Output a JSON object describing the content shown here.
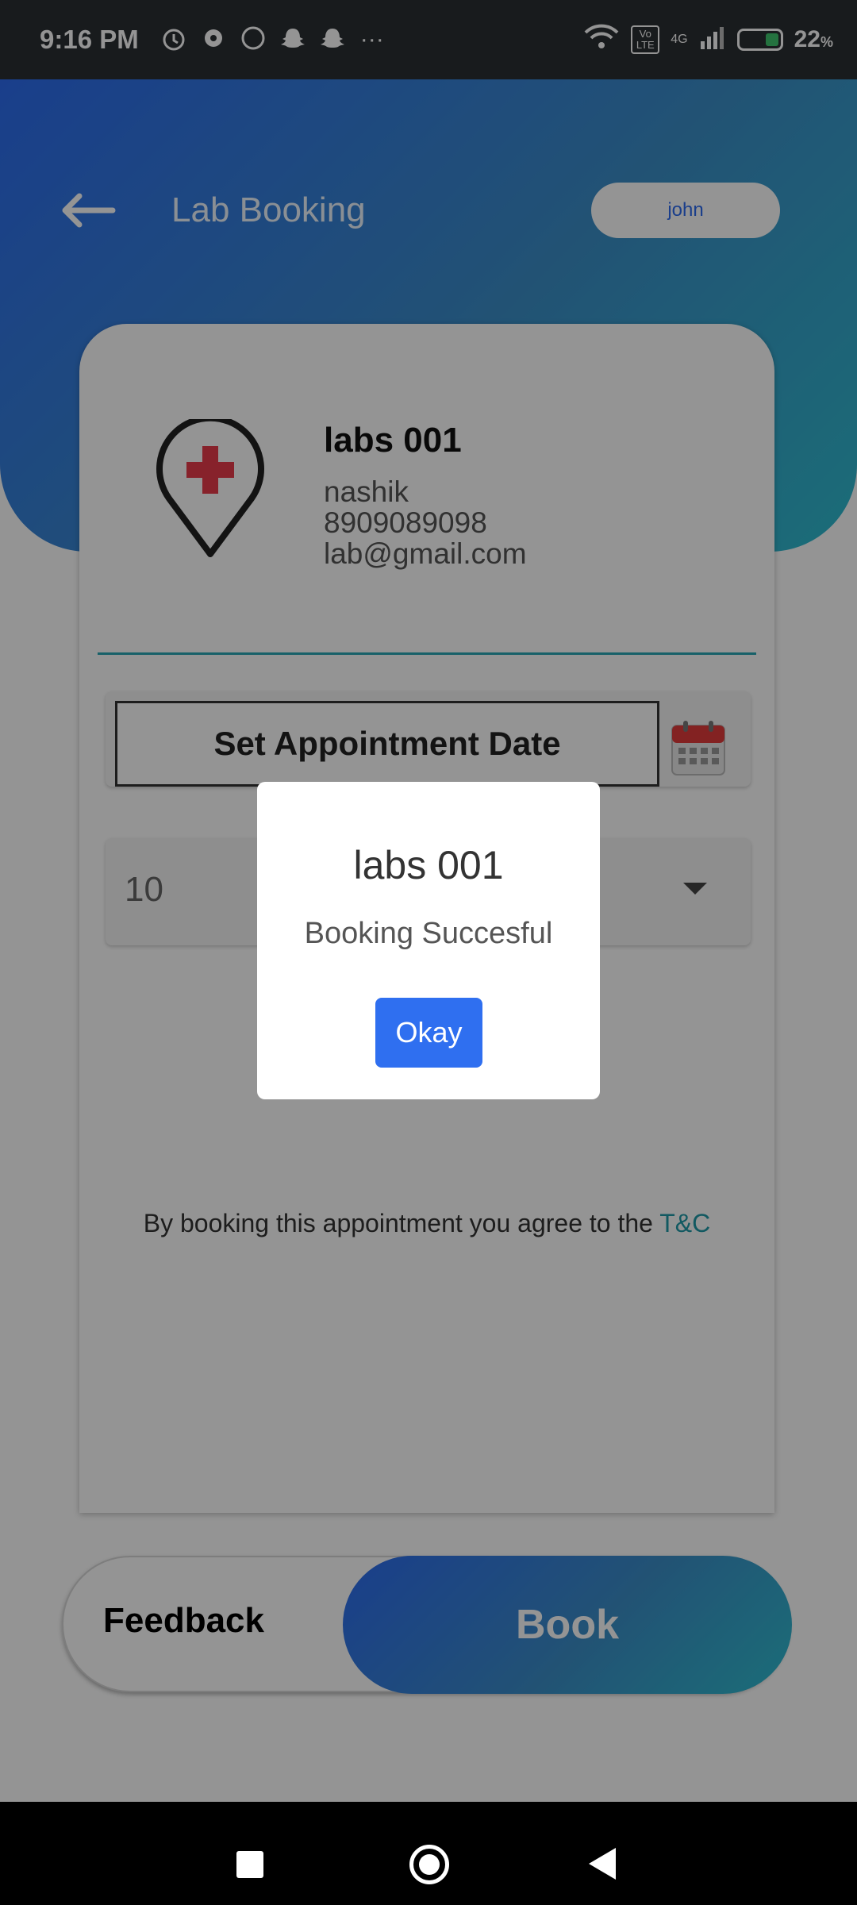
{
  "status_bar": {
    "time": "9:16 PM",
    "battery": "22",
    "battery_unit": "%",
    "network": "4G",
    "volte": "Vo LTE",
    "more": "···",
    "icons": [
      "alarm-icon",
      "settings-icon",
      "whatsapp-icon",
      "snapchat-icon",
      "snapchat-icon",
      "more-icon",
      "wifi-icon",
      "volte-icon",
      "signal-icon",
      "battery-charging-icon"
    ]
  },
  "header": {
    "title": "Lab Booking",
    "user": "john"
  },
  "lab": {
    "name": "labs 001",
    "city": "nashik",
    "phone": "8909089098",
    "email": "lab@gmail.com"
  },
  "booking": {
    "date_button_label": "Set Appointment Date",
    "slot_value": "10",
    "terms_text": "By booking this appointment you agree to the ",
    "terms_link": "T&C"
  },
  "actions": {
    "feedback_label": "Feedback",
    "book_label": "Book"
  },
  "dialog": {
    "title": "labs 001",
    "message": "Booking Succesful",
    "ok_label": "Okay"
  },
  "colors": {
    "brand_gradient_start": "#2d6cf0",
    "brand_gradient_end": "#2fbdd0",
    "accent_teal": "#1f9aa8",
    "button_blue": "#2f6ff0"
  }
}
